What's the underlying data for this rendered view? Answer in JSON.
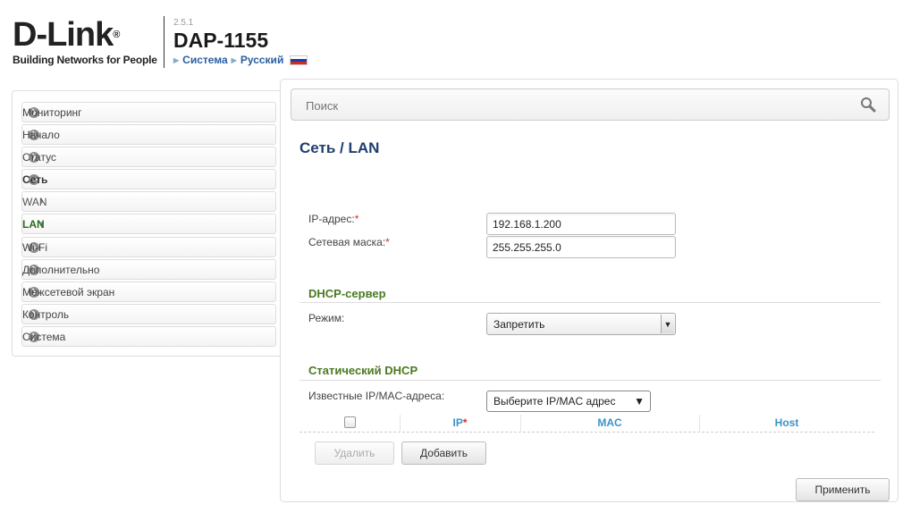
{
  "header": {
    "logo_text": "D-Link",
    "logo_reg": "®",
    "tagline": "Building Networks for People",
    "version": "2.5.1",
    "model": "DAP-1155",
    "breadcrumb": [
      "Система",
      "Русский"
    ],
    "flag_colors": [
      "#ffffff",
      "#1f3ea5",
      "#d52b1e"
    ]
  },
  "sidebar": {
    "items": [
      {
        "label": "Мониторинг",
        "icon": "chevron-right-circle-icon"
      },
      {
        "label": "Начало",
        "icon": "chevron-right-circle-icon"
      },
      {
        "label": "Статус",
        "icon": "chevron-right-circle-icon"
      },
      {
        "label": "Сеть",
        "icon": "chevron-down-circle-icon",
        "expanded": true
      },
      {
        "label": "WAN",
        "icon": "chevron-right-icon",
        "sub": true
      },
      {
        "label": "LAN",
        "icon": "chevron-right-icon",
        "sub": true,
        "active": true
      },
      {
        "label": "Wi-Fi",
        "icon": "chevron-right-circle-icon"
      },
      {
        "label": "Дополнительно",
        "icon": "chevron-right-circle-icon"
      },
      {
        "label": "Межсетевой экран",
        "icon": "chevron-right-circle-icon"
      },
      {
        "label": "Контроль",
        "icon": "chevron-right-circle-icon"
      },
      {
        "label": "Система",
        "icon": "chevron-right-circle-icon"
      }
    ]
  },
  "search": {
    "placeholder": "Поиск"
  },
  "page": {
    "title": "Сеть /  LAN",
    "ip_label": "IP-адрес:",
    "ip_value": "192.168.1.200",
    "mask_label": "Сетевая маска:",
    "mask_value": "255.255.255.0",
    "required_mark": "*"
  },
  "dhcp": {
    "section_title": "DHCP-сервер",
    "mode_label": "Режим:",
    "mode_value": "Запретить"
  },
  "static_dhcp": {
    "section_title": "Статический DHCP",
    "known_label": "Известные IP/MAC-адреса:",
    "known_value": "Выберите IP/MAC адрес",
    "columns": [
      "IP",
      "MAC",
      "Host"
    ],
    "delete_label": "Удалить",
    "add_label": "Добавить"
  },
  "apply_label": "Применить",
  "colors": {
    "accent_blue": "#1e3e6e",
    "section_green": "#4a7a21",
    "table_header": "#3a93c9"
  }
}
